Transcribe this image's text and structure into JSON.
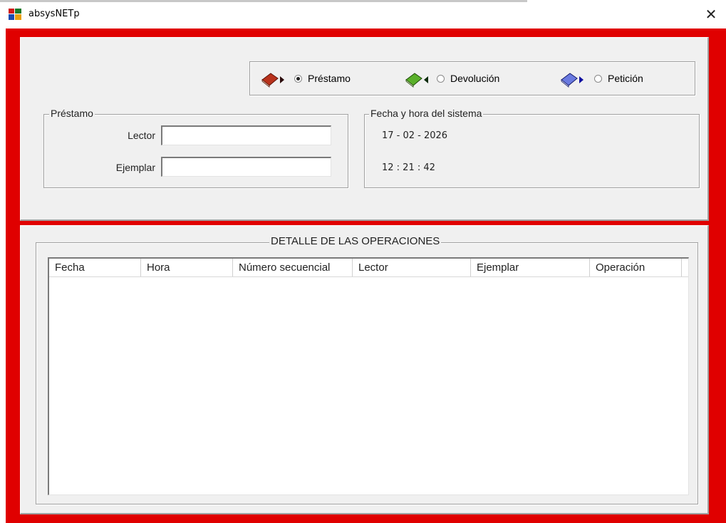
{
  "window": {
    "title": "absysNETp",
    "close_glyph": "✕"
  },
  "colors": {
    "frame": "#e00000",
    "panel": "#f0f0f0"
  },
  "options": [
    {
      "label": "Préstamo",
      "selected": true,
      "icon": "book-red-arrow-icon"
    },
    {
      "label": "Devolución",
      "selected": false,
      "icon": "book-green-arrow-icon"
    },
    {
      "label": "Petición",
      "selected": false,
      "icon": "book-blue-arrow-icon"
    }
  ],
  "prestamo": {
    "legend": "Préstamo",
    "lector_label": "Lector",
    "lector_value": "",
    "ejemplar_label": "Ejemplar",
    "ejemplar_value": ""
  },
  "sistema": {
    "legend": "Fecha y hora del sistema",
    "fecha": "17 - 02 - 2026",
    "hora": "12 : 21 : 42"
  },
  "detalle": {
    "legend": "DETALLE DE LAS OPERACIONES",
    "columns": [
      "Fecha",
      "Hora",
      "Número secuencial",
      "Lector",
      "Ejemplar",
      "Operación"
    ],
    "rows": []
  }
}
